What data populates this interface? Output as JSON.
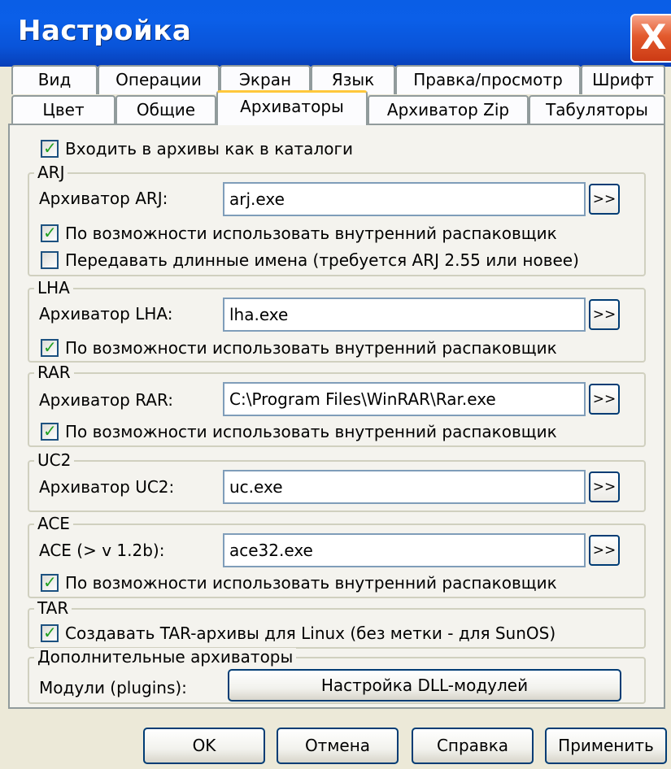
{
  "window": {
    "title": "Настройка",
    "close_glyph": "X"
  },
  "tabs_row1": [
    "Вид",
    "Операции",
    "Экран",
    "Язык",
    "Правка/просмотр",
    "Шрифт"
  ],
  "tabs_row2": [
    "Цвет",
    "Общие",
    "Архиваторы",
    "Архиватор Zip",
    "Табуляторы"
  ],
  "selected_tab": "Архиваторы",
  "top_checkbox": {
    "label": "Входить в архивы как в каталоги",
    "checked": true
  },
  "arj": {
    "group": "ARJ",
    "label": "Архиватор ARJ:",
    "value": "arj.exe",
    "cb1": {
      "label": "По возможности использовать внутренний распаковщик",
      "checked": true
    },
    "cb2": {
      "label": "Передавать длинные имена (требуется ARJ 2.55 или новее)",
      "checked": false
    }
  },
  "lha": {
    "group": "LHA",
    "label": "Архиватор LHA:",
    "value": "lha.exe",
    "cb1": {
      "label": "По возможности использовать внутренний распаковщик",
      "checked": true
    }
  },
  "rar": {
    "group": "RAR",
    "label": "Архиватор RAR:",
    "value": "C:\\Program Files\\WinRAR\\Rar.exe",
    "cb1": {
      "label": "По возможности использовать внутренний распаковщик",
      "checked": true
    }
  },
  "uc2": {
    "group": "UC2",
    "label": "Архиватор UC2:",
    "value": "uc.exe"
  },
  "ace": {
    "group": "ACE",
    "label": "ACE (> v 1.2b):",
    "value": "ace32.exe",
    "cb1": {
      "label": "По возможности использовать внутренний распаковщик",
      "checked": true
    }
  },
  "tar": {
    "group": "TAR",
    "cb1": {
      "label": "Создавать TAR-архивы для Linux (без метки - для SunOS)",
      "checked": true
    }
  },
  "extra": {
    "group": "Дополнительные архиваторы",
    "label": "Модули (plugins):",
    "button": "Настройка DLL-модулей"
  },
  "browse_label": ">>",
  "check_glyph": "✓",
  "footer": {
    "ok": "OK",
    "cancel": "Отмена",
    "help": "Справка",
    "apply": "Применить"
  },
  "colors": {
    "titlebar": "#0a5ee6",
    "close": "#e35a2d",
    "selected_tab_accent": "#ffc83c",
    "check": "#21a121"
  }
}
